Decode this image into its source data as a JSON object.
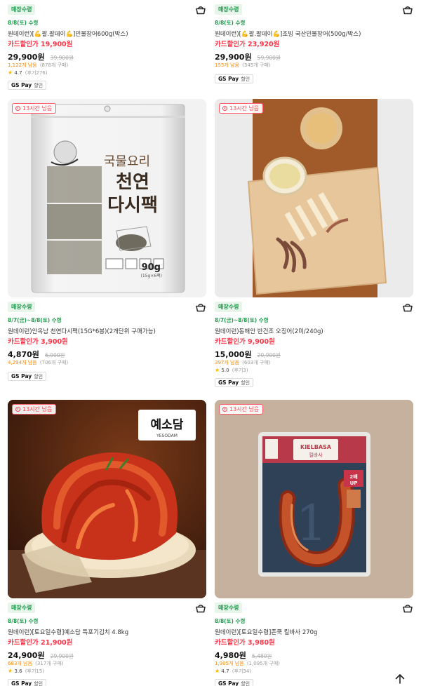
{
  "common": {
    "pickup_tag": "매장수령",
    "gspay_brand": "GS Pay",
    "gspay_label": "할인",
    "star_glyph": "★",
    "cart_icon": "shopping-basket-icon",
    "timer_icon": "clock-icon",
    "accent_green": "#1f9a4c",
    "accent_red": "#ff3547",
    "accent_orange": "#ff8a00"
  },
  "products": [
    {
      "date": "8/8(토) 수령",
      "name": "원데이런)[💪팔.팔데이💪]민물장어600g(박스)",
      "card_price": "카드할인가 19,900원",
      "price": "29,900원",
      "orig_price": "39,900원",
      "stock": "1,122개 남음",
      "buyers": "(878개 구매)",
      "rating": "4.7",
      "reviews": "(후기276)"
    },
    {
      "date": "8/8(토) 수령",
      "name": "원데이런)[💪팔.팔데이💪]조빙 국산민물장어(500g/박스)",
      "card_price": "카드할인가 23,920원",
      "price": "29,900원",
      "orig_price": "59,900원",
      "stock": "155개 남음",
      "buyers": "(345개 구매)"
    },
    {
      "timer": "13시간 남음",
      "image_title": "국물요리 천연 다시팩",
      "image_weight": "90g",
      "image_weight_sub": "(15g×6팩)",
      "date": "8/7(금)~8/8(토) 수령",
      "name": "원데이런)안옥남 천연다시팩(15G*6봉)(2개단위 구매가능)",
      "card_price": "카드할인가 3,900원",
      "price": "4,870원",
      "orig_price": "6,000원",
      "stock": "4,294개 남음",
      "buyers": "(706개 구매)"
    },
    {
      "timer": "13시간 남음",
      "date": "8/7(금)~8/8(토) 수령",
      "name": "원데이런)동해안 반건조 오징어(2미/240g)",
      "card_price": "카드할인가 9,900원",
      "price": "15,000원",
      "orig_price": "20,900원",
      "stock": "397개 남음",
      "buyers": "(603개 구매)",
      "rating": "5.0",
      "reviews": "(후기3)"
    },
    {
      "timer": "13시간 남음",
      "image_brand": "예소담",
      "image_brand_sub": "YESODAM",
      "date": "8/8(토) 수령",
      "name": "원데이런)[토요일수령]예소담 특포기김치 4.8kg",
      "card_price": "카드할인가 21,900원",
      "price": "24,900원",
      "orig_price": "29,900원",
      "stock": "683개 남음",
      "buyers": "(317개 구매)",
      "rating": "3.6",
      "reviews": "(후기15)"
    },
    {
      "timer": "13시간 남음",
      "image_brand": "KIELBASA",
      "image_badge": "2배 UP",
      "image_numeral": "1",
      "date": "8/8(토) 수령",
      "name": "원데이런)[토요일수령]존쿡 킬바사 270g",
      "card_price": "카드할인가 3,980원",
      "price": "4,980원",
      "orig_price": "5,480원",
      "stock": "1,905개 남음",
      "buyers": "(1,095개 구매)",
      "rating": "4.7",
      "reviews": "(후기34)"
    }
  ]
}
